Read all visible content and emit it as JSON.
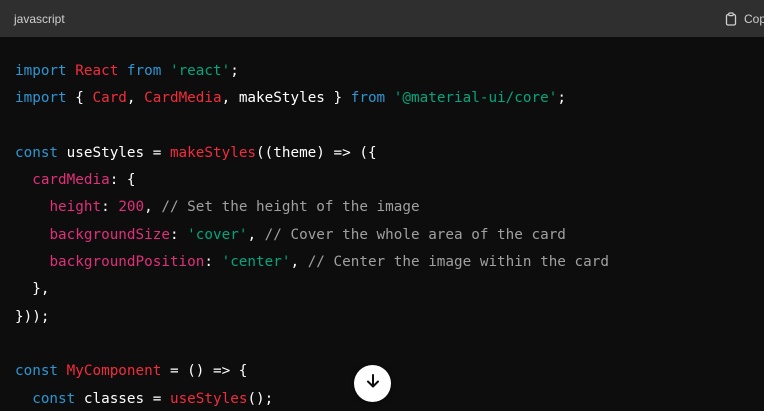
{
  "header": {
    "language": "javascript",
    "copy_label": "Copy"
  },
  "icons": {
    "copy": "clipboard-icon",
    "scroll_down": "arrow-down-icon"
  },
  "colors": {
    "keyword": "#2e95d3",
    "class_name": "#f22c3d",
    "string": "#00a67d",
    "property": "#df3079",
    "comment": "#a0a0a0",
    "text": "#ffffff",
    "header_bg": "#2f2f2f",
    "code_bg": "#0d0d0d"
  },
  "code_lines": [
    [
      [
        "kw",
        "import"
      ],
      [
        "pun",
        " "
      ],
      [
        "cls",
        "React"
      ],
      [
        "pun",
        " "
      ],
      [
        "kw",
        "from"
      ],
      [
        "pun",
        " "
      ],
      [
        "str",
        "'react'"
      ],
      [
        "pun",
        ";"
      ]
    ],
    [
      [
        "kw",
        "import"
      ],
      [
        "pun",
        " { "
      ],
      [
        "cls",
        "Card"
      ],
      [
        "pun",
        ", "
      ],
      [
        "cls",
        "CardMedia"
      ],
      [
        "pun",
        ", "
      ],
      [
        "id",
        "makeStyles"
      ],
      [
        "pun",
        " } "
      ],
      [
        "kw",
        "from"
      ],
      [
        "pun",
        " "
      ],
      [
        "str",
        "'@material-ui/core'"
      ],
      [
        "pun",
        ";"
      ]
    ],
    [],
    [
      [
        "kw",
        "const"
      ],
      [
        "pun",
        " "
      ],
      [
        "id",
        "useStyles"
      ],
      [
        "pun",
        " = "
      ],
      [
        "fn",
        "makeStyles"
      ],
      [
        "pun",
        "(("
      ],
      [
        "id",
        "theme"
      ],
      [
        "pun",
        ") => ({"
      ]
    ],
    [
      [
        "pun",
        "  "
      ],
      [
        "prop",
        "cardMedia"
      ],
      [
        "pun",
        ": {"
      ]
    ],
    [
      [
        "pun",
        "    "
      ],
      [
        "prop",
        "height"
      ],
      [
        "pun",
        ": "
      ],
      [
        "num",
        "200"
      ],
      [
        "pun",
        ", "
      ],
      [
        "com",
        "// Set the height of the image"
      ]
    ],
    [
      [
        "pun",
        "    "
      ],
      [
        "prop",
        "backgroundSize"
      ],
      [
        "pun",
        ": "
      ],
      [
        "str",
        "'cover'"
      ],
      [
        "pun",
        ", "
      ],
      [
        "com",
        "// Cover the whole area of the card"
      ]
    ],
    [
      [
        "pun",
        "    "
      ],
      [
        "prop",
        "backgroundPosition"
      ],
      [
        "pun",
        ": "
      ],
      [
        "str",
        "'center'"
      ],
      [
        "pun",
        ", "
      ],
      [
        "com",
        "// Center the image within the card"
      ]
    ],
    [
      [
        "pun",
        "  },"
      ]
    ],
    [
      [
        "pun",
        "}));"
      ]
    ],
    [],
    [
      [
        "kw",
        "const"
      ],
      [
        "pun",
        " "
      ],
      [
        "cls",
        "MyComponent"
      ],
      [
        "pun",
        " = () => {"
      ]
    ],
    [
      [
        "pun",
        "  "
      ],
      [
        "kw",
        "const"
      ],
      [
        "pun",
        " "
      ],
      [
        "id",
        "classes"
      ],
      [
        "pun",
        " = "
      ],
      [
        "fn",
        "useStyles"
      ],
      [
        "pun",
        "();"
      ]
    ]
  ]
}
